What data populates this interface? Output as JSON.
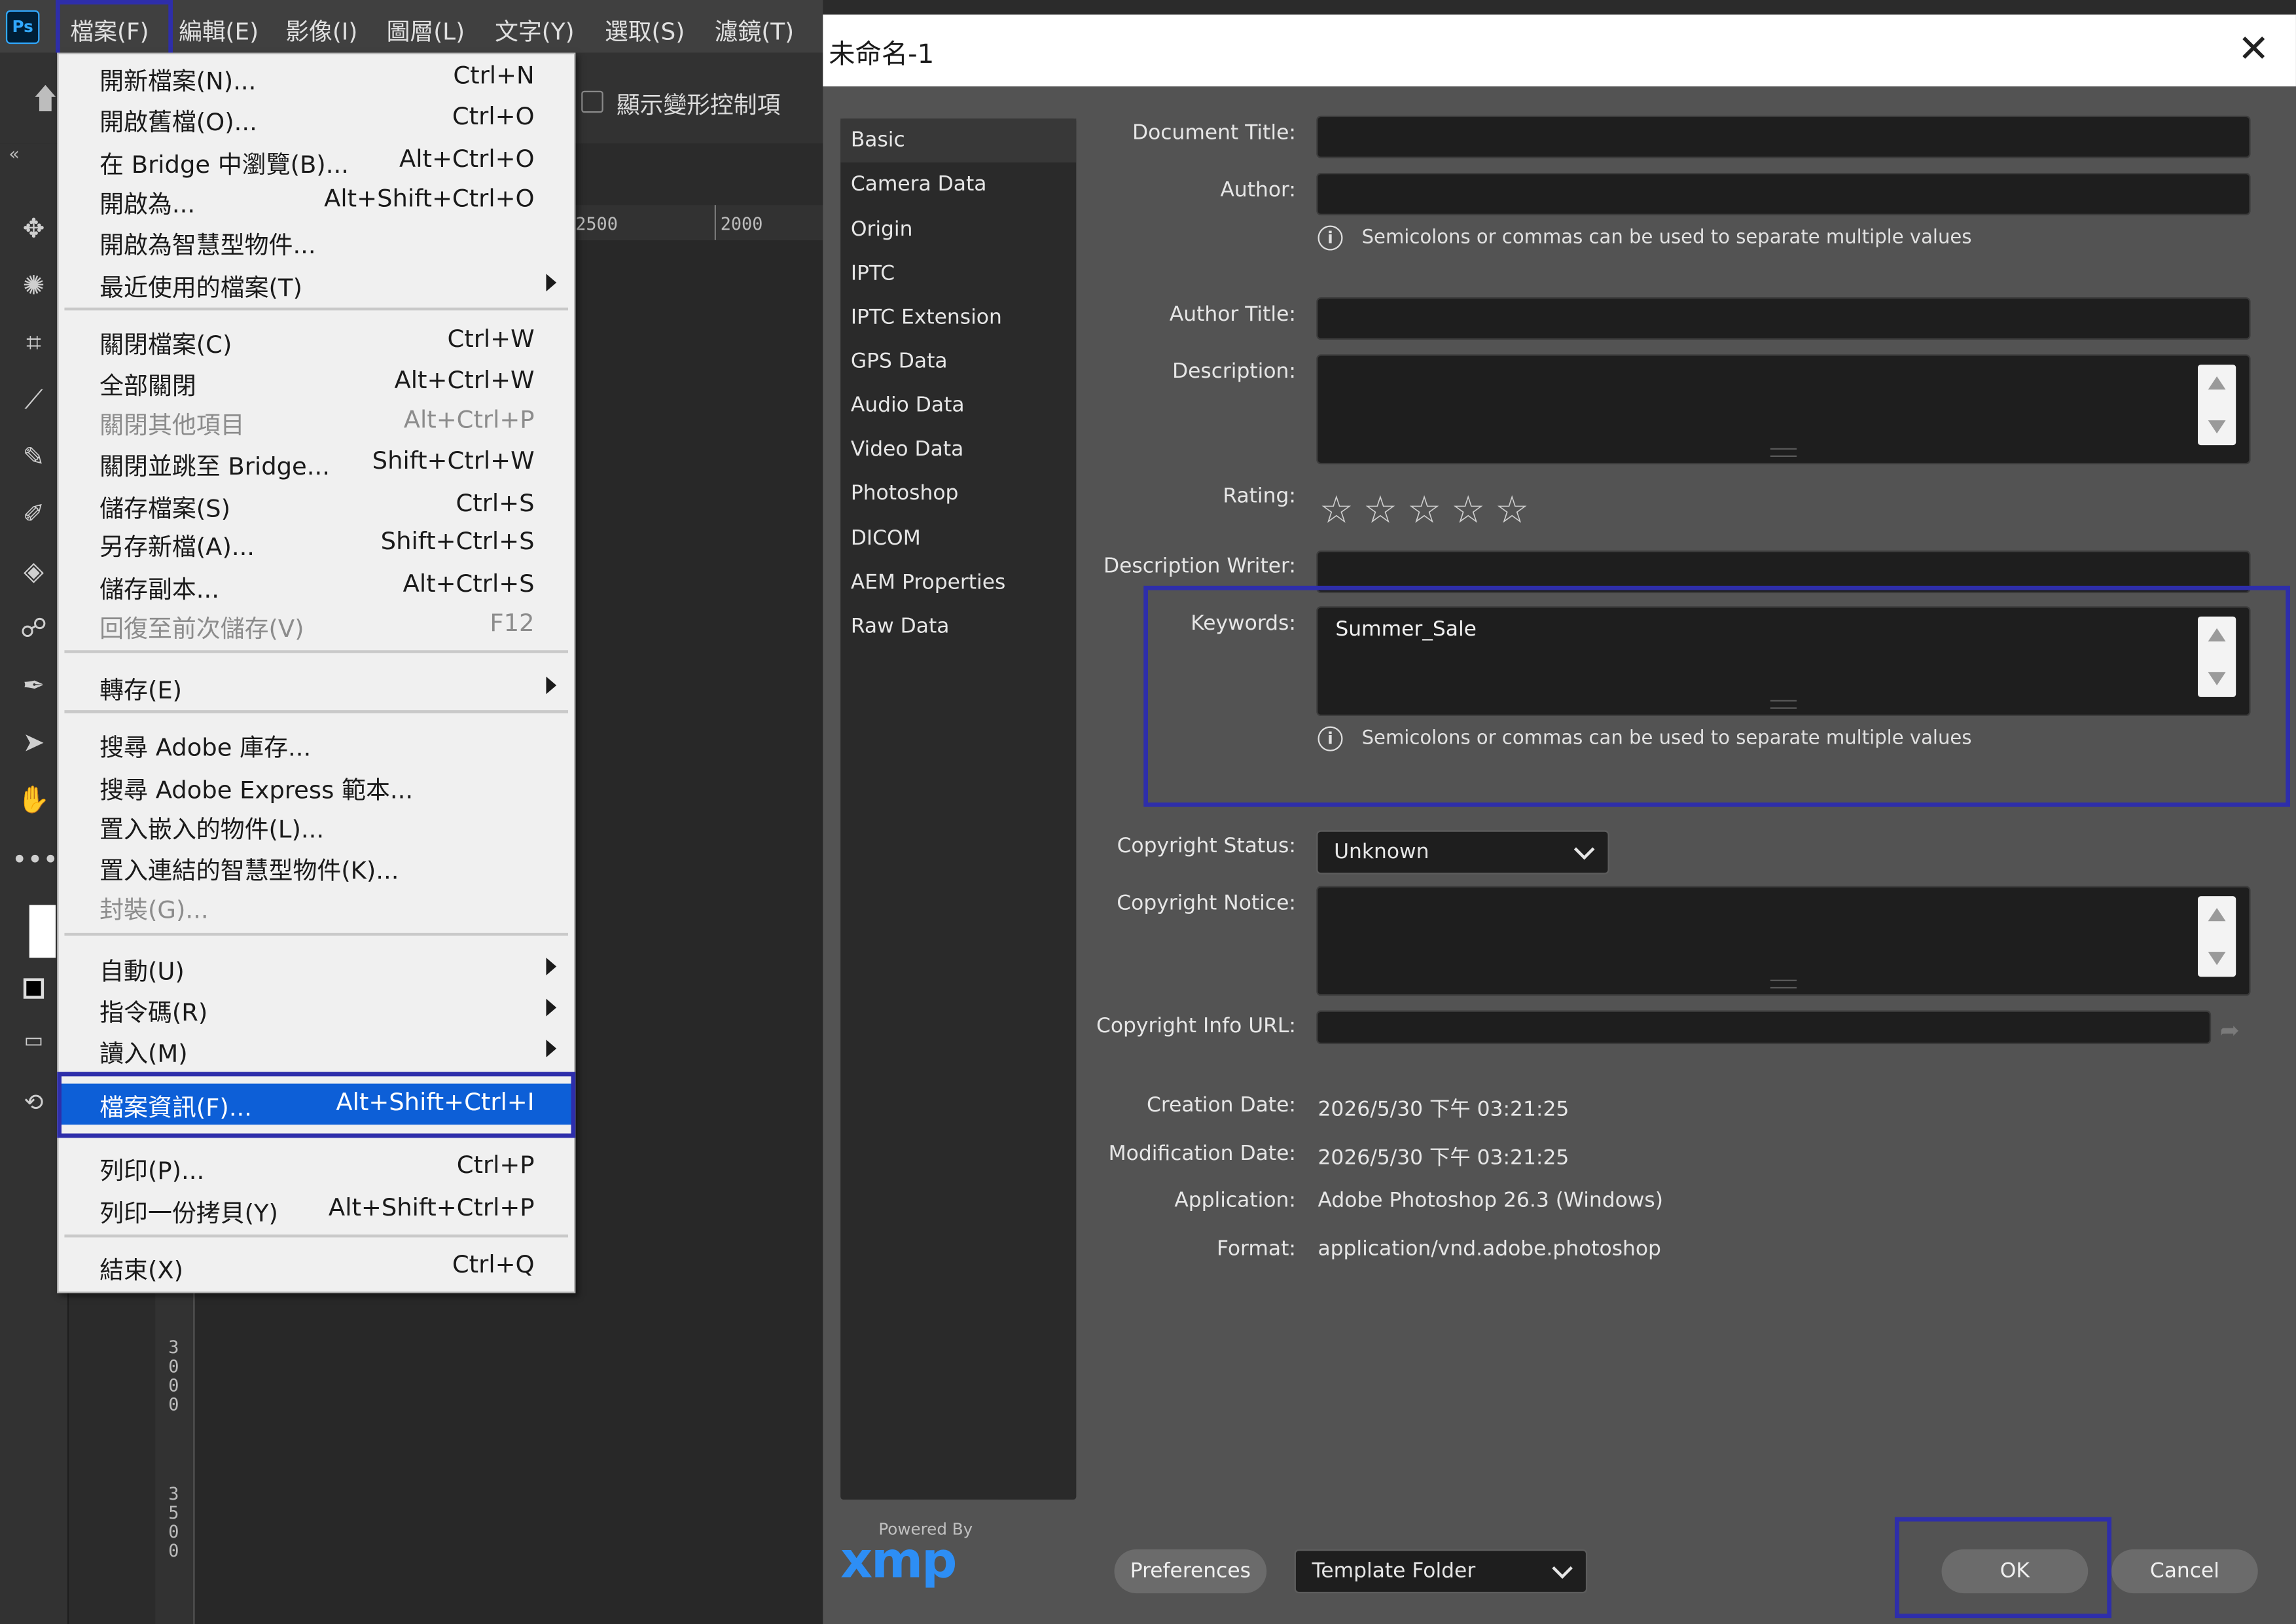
{
  "app": {
    "logo": "Ps"
  },
  "menubar": [
    {
      "label": "檔案(F)"
    },
    {
      "label": "編輯(E)"
    },
    {
      "label": "影像(I)"
    },
    {
      "label": "圖層(L)"
    },
    {
      "label": "文字(Y)"
    },
    {
      "label": "選取(S)"
    },
    {
      "label": "濾鏡(T)"
    }
  ],
  "options_bar": {
    "show_transform_controls": "顯示變形控制項"
  },
  "rulers": {
    "top": [
      "2500",
      "2000"
    ],
    "left": [
      "3000",
      "3500"
    ]
  },
  "tools": [
    "move-icon",
    "quick-select-icon",
    "crop-icon",
    "eyedropper-icon",
    "brush-icon",
    "healing-icon",
    "paint-bucket-icon",
    "smudge-icon",
    "pen-icon",
    "path-select-icon",
    "hand-icon",
    "more-icon"
  ],
  "file_menu": {
    "items": [
      {
        "label": "開新檔案(N)...",
        "shortcut": "Ctrl+N"
      },
      {
        "label": "開啟舊檔(O)...",
        "shortcut": "Ctrl+O"
      },
      {
        "label": "在 Bridge 中瀏覽(B)...",
        "shortcut": "Alt+Ctrl+O"
      },
      {
        "label": "開啟為...",
        "shortcut": "Alt+Shift+Ctrl+O"
      },
      {
        "label": "開啟為智慧型物件...",
        "shortcut": ""
      },
      {
        "label": "最近使用的檔案(T)",
        "shortcut": ""
      },
      {
        "label": "關閉檔案(C)",
        "shortcut": "Ctrl+W"
      },
      {
        "label": "全部關閉",
        "shortcut": "Alt+Ctrl+W"
      },
      {
        "label": "關閉其他項目",
        "shortcut": "Alt+Ctrl+P"
      },
      {
        "label": "關閉並跳至 Bridge...",
        "shortcut": "Shift+Ctrl+W"
      },
      {
        "label": "儲存檔案(S)",
        "shortcut": "Ctrl+S"
      },
      {
        "label": "另存新檔(A)...",
        "shortcut": "Shift+Ctrl+S"
      },
      {
        "label": "儲存副本...",
        "shortcut": "Alt+Ctrl+S"
      },
      {
        "label": "回復至前次儲存(V)",
        "shortcut": "F12"
      },
      {
        "label": "轉存(E)",
        "shortcut": ""
      },
      {
        "label": "搜尋 Adobe 庫存...",
        "shortcut": ""
      },
      {
        "label": "搜尋 Adobe Express 範本...",
        "shortcut": ""
      },
      {
        "label": "置入嵌入的物件(L)...",
        "shortcut": ""
      },
      {
        "label": "置入連結的智慧型物件(K)...",
        "shortcut": ""
      },
      {
        "label": "封裝(G)...",
        "shortcut": ""
      },
      {
        "label": "自動(U)",
        "shortcut": ""
      },
      {
        "label": "指令碼(R)",
        "shortcut": ""
      },
      {
        "label": "讀入(M)",
        "shortcut": ""
      },
      {
        "label": "檔案資訊(F)...",
        "shortcut": "Alt+Shift+Ctrl+I"
      },
      {
        "label": "列印(P)...",
        "shortcut": "Ctrl+P"
      },
      {
        "label": "列印一份拷貝(Y)",
        "shortcut": "Alt+Shift+Ctrl+P"
      },
      {
        "label": "結束(X)",
        "shortcut": "Ctrl+Q"
      }
    ]
  },
  "dialog": {
    "title": "未命名-1",
    "sidebar": [
      "Basic",
      "Camera Data",
      "Origin",
      "IPTC",
      "IPTC Extension",
      "GPS Data",
      "Audio Data",
      "Video Data",
      "Photoshop",
      "DICOM",
      "AEM Properties",
      "Raw Data"
    ],
    "labels": {
      "document_title": "Document Title:",
      "author": "Author:",
      "author_title": "Author Title:",
      "description": "Description:",
      "rating": "Rating:",
      "description_writer": "Description Writer:",
      "keywords": "Keywords:",
      "copyright_status": "Copyright Status:",
      "copyright_notice": "Copyright Notice:",
      "copyright_info_url": "Copyright Info URL:",
      "creation_date": "Creation Date:",
      "modification_date": "Modification Date:",
      "application": "Application:",
      "format": "Format:"
    },
    "hint": "Semicolons or commas can be used to separate multiple values",
    "keywords_value": "Summer_Sale",
    "rating_stars": "☆",
    "rating_value": 0,
    "copyright_status_value": "Unknown",
    "creation_date_value": "2026/5/30 下午 03:21:25",
    "modification_date_value": "2026/5/30 下午 03:21:25",
    "application_value": "Adobe Photoshop 26.3 (Windows)",
    "format_value": "application/vnd.adobe.photoshop",
    "powered_by": "Powered By",
    "xmp_logo": "xmp",
    "buttons": {
      "preferences": "Preferences",
      "template_folder": "Template Folder",
      "ok": "OK",
      "cancel": "Cancel"
    }
  },
  "colors": {
    "highlight": "#2e2eaa",
    "menu_selected": "#0d5fd7",
    "xmp": "#2d8ef5"
  }
}
